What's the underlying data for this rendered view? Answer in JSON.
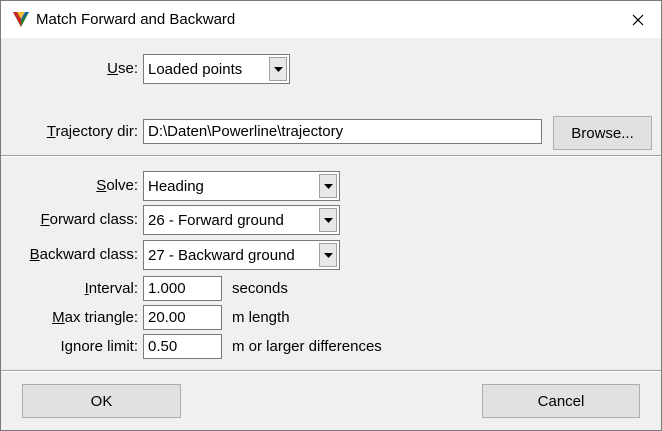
{
  "window": {
    "title": "Match Forward and Backward"
  },
  "form": {
    "use": {
      "label_u": "U",
      "label_rest": "se:",
      "value": "Loaded points"
    },
    "trajectory": {
      "label_u": "T",
      "label_rest": "rajectory dir:",
      "value": "D:\\Daten\\Powerline\\trajectory",
      "browse_label": "Browse..."
    },
    "solve": {
      "label_u": "S",
      "label_rest": "olve:",
      "value": "Heading"
    },
    "forward_class": {
      "label_u": "F",
      "label_rest": "orward class:",
      "value": "26 - Forward ground"
    },
    "backward_class": {
      "label_u": "B",
      "label_rest": "ackward class:",
      "value": "27 - Backward ground"
    },
    "interval": {
      "label_u": "I",
      "label_rest": "nterval:",
      "value": "1.000",
      "unit": "seconds"
    },
    "max_triangle": {
      "label_u": "M",
      "label_rest": "ax triangle:",
      "value": "20.00",
      "unit": "m length"
    },
    "ignore_limit": {
      "label_u": "",
      "label_rest": "Ignore limit:",
      "value": "0.50",
      "unit": "m or larger differences"
    }
  },
  "footer": {
    "ok_label": "OK",
    "cancel_label": "Cancel"
  },
  "colors": {
    "dialog_bg": "#f0f0f0",
    "titlebar_bg": "#ffffff",
    "button_bg": "#e1e1e1"
  }
}
